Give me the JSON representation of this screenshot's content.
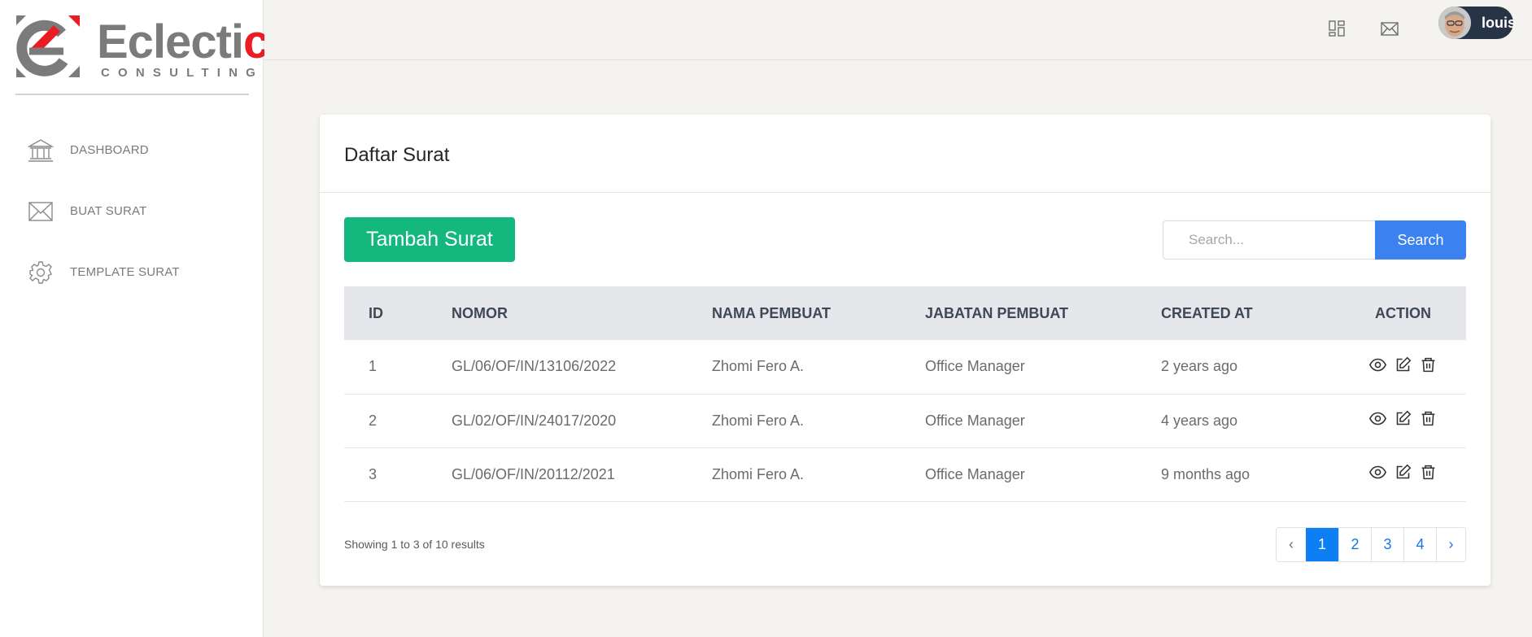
{
  "brand": {
    "name_part1": "Eclecti",
    "name_part2": "c",
    "tagline": "CONSULTING",
    "colors": {
      "grey": "#7b7b7b",
      "red": "#ea1c24"
    }
  },
  "sidebar": {
    "items": [
      {
        "label": "DASHBOARD",
        "icon": "bank-icon"
      },
      {
        "label": "BUAT SURAT",
        "icon": "envelope-icon"
      },
      {
        "label": "TEMPLATE SURAT",
        "icon": "gear-icon"
      }
    ]
  },
  "topbar": {
    "icons": [
      "dashboard-grid-icon",
      "mail-icon"
    ],
    "user": {
      "name": "louis"
    }
  },
  "card": {
    "title": "Daftar Surat",
    "add_button": "Tambah Surat",
    "search": {
      "placeholder": "Search...",
      "button": "Search"
    },
    "table": {
      "headers": [
        "ID",
        "NOMOR",
        "NAMA PEMBUAT",
        "JABATAN PEMBUAT",
        "CREATED AT",
        "ACTION"
      ],
      "rows": [
        {
          "id": "1",
          "nomor": "GL/06/OF/IN/13106/2022",
          "nama": "Zhomi Fero A.",
          "jabatan": "Office Manager",
          "created": "2 years ago"
        },
        {
          "id": "2",
          "nomor": "GL/02/OF/IN/24017/2020",
          "nama": "Zhomi Fero A.",
          "jabatan": "Office Manager",
          "created": "4 years ago"
        },
        {
          "id": "3",
          "nomor": "GL/06/OF/IN/20112/2021",
          "nama": "Zhomi Fero A.",
          "jabatan": "Office Manager",
          "created": "9 months ago"
        }
      ],
      "action_icons": [
        "eye-icon",
        "edit-icon",
        "trash-icon"
      ]
    },
    "result_text": "Showing 1 to 3 of 10 results",
    "pagination": {
      "prev": "‹",
      "pages": [
        "1",
        "2",
        "3",
        "4"
      ],
      "next": "›",
      "current": "1"
    }
  },
  "colors": {
    "accent_green": "#14b87e",
    "accent_blue": "#3b82f0",
    "page_active": "#0d7ef3",
    "sidebar_bg": "#ffffff",
    "page_bg": "#f4f3f0"
  }
}
